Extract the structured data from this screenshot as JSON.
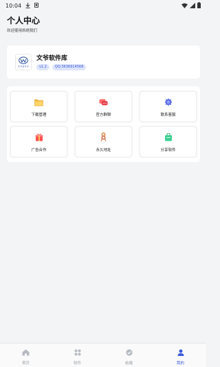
{
  "status_bar": {
    "time": "10:04",
    "icons": [
      "download-icon",
      "notification-icon",
      "wifi-icon",
      "signal-icon",
      "battery-icon"
    ]
  },
  "header": {
    "title": "个人中心",
    "subtitle": "欢迎使用凯绝我们"
  },
  "profile": {
    "logo_icon": "app-logo-icon",
    "logo_text": "文 爷 软 件 库",
    "app_name": "文爷软件库",
    "version_badge": "v1.2",
    "qq_badge": "QQ:3636914568"
  },
  "menu": {
    "items": [
      {
        "label": "下载管理",
        "icon": "folder-icon"
      },
      {
        "label": "官方群聊",
        "icon": "chat-icon"
      },
      {
        "label": "联系客服",
        "icon": "customer-service-icon"
      },
      {
        "label": "广告合作",
        "icon": "gift-icon"
      },
      {
        "label": "永久地址",
        "icon": "link-icon"
      },
      {
        "label": "分享软件",
        "icon": "share-icon"
      }
    ]
  },
  "bottom_nav": {
    "items": [
      {
        "label": "首页",
        "icon": "home-icon",
        "active": false
      },
      {
        "label": "软件",
        "icon": "grid-icon",
        "active": false
      },
      {
        "label": "结婚",
        "icon": "check-circle-icon",
        "active": false
      },
      {
        "label": "我的",
        "icon": "user-icon",
        "active": true
      }
    ]
  },
  "colors": {
    "accent": "#3b5bdb",
    "badge_bg": "#dde4fb",
    "page_bg": "#f3f4f6",
    "inactive_nav": "#9aa0a6"
  }
}
